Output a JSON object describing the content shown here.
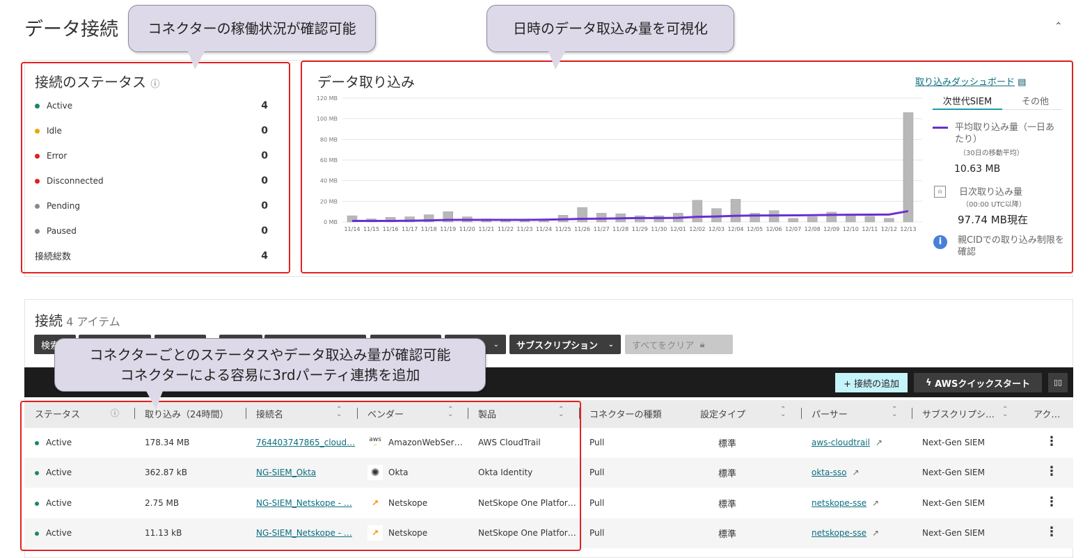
{
  "page": {
    "title": "データ接続",
    "collapse_icon": "chevron-up"
  },
  "callouts": {
    "status": "コネクターの稼働状況が確認可能",
    "ingest": "日時のデータ取込み量を可視化",
    "table_line1": "コネクターごとのステータスやデータ取込み量が確認可能",
    "table_line2": "コネクターによる容易に3rdパーティ連携を追加"
  },
  "status_panel": {
    "title": "接続のステータス",
    "items": [
      {
        "label": "Active",
        "count": "4",
        "color": "#1a8a5a"
      },
      {
        "label": "Idle",
        "count": "0",
        "color": "#e8a800"
      },
      {
        "label": "Error",
        "count": "0",
        "color": "#e02020"
      },
      {
        "label": "Disconnected",
        "count": "0",
        "color": "#e02020"
      },
      {
        "label": "Pending",
        "count": "0",
        "color": "#888888"
      },
      {
        "label": "Paused",
        "count": "0",
        "color": "#888888"
      }
    ],
    "total_label": "接続総数",
    "total": "4"
  },
  "ingest_panel": {
    "title": "データ取り込み",
    "dashboard_link": "取り込みダッシュボード",
    "tabs": [
      "次世代SIEM",
      "その他"
    ],
    "active_tab": 0,
    "avg_label": "平均取り込み量（一日あたり）",
    "avg_sub": "（30日の移動平均）",
    "avg_value": "10.63 MB",
    "daily_label": "日次取り込み量",
    "daily_sub": "（00:00 UTC以降）",
    "daily_value": "97.74 MB現在",
    "limit_link": "親CIDでの取り込み制限を確認"
  },
  "chart_data": {
    "type": "bar",
    "yticks": [
      "0 MB",
      "20 MB",
      "40 MB",
      "60 MB",
      "80 MB",
      "100 MB",
      "120 MB"
    ],
    "ylim": [
      0,
      120
    ],
    "grid": true,
    "categories": [
      "11/14",
      "11/15",
      "11/16",
      "11/17",
      "11/18",
      "11/19",
      "11/20",
      "11/21",
      "11/22",
      "11/23",
      "11/24",
      "11/25",
      "11/26",
      "11/27",
      "11/28",
      "11/29",
      "11/30",
      "12/01",
      "12/02",
      "12/03",
      "12/04",
      "12/05",
      "12/06",
      "12/07",
      "12/08",
      "12/09",
      "12/10",
      "12/11",
      "12/12",
      "12/13"
    ],
    "series": [
      {
        "type": "bar",
        "color": "#b8b8b8",
        "values": [
          6,
          3,
          4.5,
          5,
          7,
          10,
          5,
          3,
          1,
          1,
          1,
          6.5,
          14,
          8.5,
          8,
          6,
          6,
          8.5,
          21,
          13,
          22,
          8.5,
          11,
          3.5,
          5,
          9.5,
          7,
          5.5,
          3.5,
          106
        ]
      },
      {
        "type": "line",
        "color": "#6a2fd0",
        "values": [
          1,
          1,
          1,
          1.2,
          1.5,
          2,
          2,
          2,
          2,
          2,
          2.2,
          2.5,
          3,
          3.2,
          3.5,
          3.8,
          3.8,
          4,
          5,
          5.3,
          6,
          6.2,
          6.3,
          6.4,
          6.6,
          6.8,
          7,
          7.1,
          7.2,
          10.5
        ]
      }
    ]
  },
  "connections": {
    "title": "接続",
    "count": "4 アイテム",
    "filters": [
      "検索",
      "",
      "",
      "",
      "",
      "",
      "ー",
      "サブスクリプション"
    ],
    "clear_all": "すべてをクリア",
    "add_button": "+ 接続の追加",
    "aws_button": "AWSクイックスタート",
    "columns": [
      "ステータス",
      "取り込み（24時間）",
      "接続名",
      "ベンダー",
      "製品",
      "コネクターの種類",
      "設定タイプ",
      "パーサー",
      "サブスクリプシ…",
      "アク…"
    ],
    "rows": [
      {
        "status": "Active",
        "ingest": "178.34 MB",
        "name": "764403747865_cloud…",
        "vendor": "AmazonWebSer…",
        "vendor_icon": "aws",
        "product": "AWS CloudTrail",
        "type": "Pull",
        "config": "標準",
        "parser": "aws-cloudtrail",
        "subscription": "Next-Gen SIEM"
      },
      {
        "status": "Active",
        "ingest": "362.87 kB",
        "name": "NG-SIEM_Okta",
        "vendor": "Okta",
        "vendor_icon": "okta",
        "product": "Okta Identity",
        "type": "Pull",
        "config": "標準",
        "parser": "okta-sso",
        "subscription": "Next-Gen SIEM"
      },
      {
        "status": "Active",
        "ingest": "2.75 MB",
        "name": "NG-SIEM_Netskope - …",
        "vendor": "Netskope",
        "vendor_icon": "netskope",
        "product": "NetSkope One Platfor…",
        "type": "Pull",
        "config": "標準",
        "parser": "netskope-sse",
        "subscription": "Next-Gen SIEM"
      },
      {
        "status": "Active",
        "ingest": "11.13 kB",
        "name": "NG-SIEM_Netskope - …",
        "vendor": "Netskope",
        "vendor_icon": "netskope",
        "product": "NetSkope One Platfor…",
        "type": "Pull",
        "config": "標準",
        "parser": "netskope-sse",
        "subscription": "Next-Gen SIEM"
      }
    ]
  }
}
